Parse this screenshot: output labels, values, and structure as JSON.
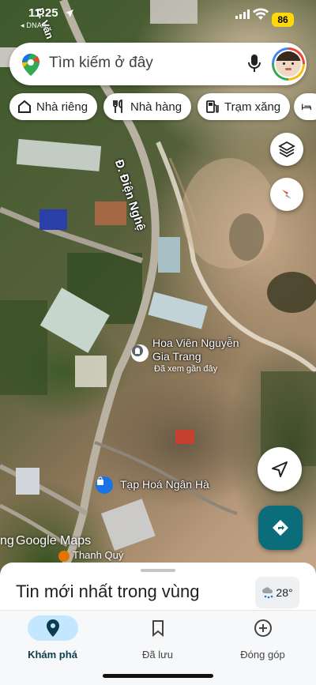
{
  "status_bar": {
    "time": "11:25",
    "carrier": "DNAIL",
    "battery": "86"
  },
  "search": {
    "placeholder": "Tìm kiếm ở đây"
  },
  "chips": [
    {
      "label": "Nhà riêng",
      "icon": "home-icon"
    },
    {
      "label": "Nhà hàng",
      "icon": "restaurant-icon"
    },
    {
      "label": "Trạm xăng",
      "icon": "gas-station-icon"
    },
    {
      "label": "",
      "icon": "hotel-icon"
    }
  ],
  "map": {
    "road_main": "Đ. Điện Nghệ",
    "road_top": "Đ. Văn",
    "poi_garden": {
      "name": "Hoa Viên Nguyễn Gia Trang",
      "line1": "Hoa Viên Nguyễn",
      "line2": "Gia Trang",
      "sub": "Đã xem gần đây",
      "icon": "cemetery-icon"
    },
    "poi_store": {
      "name": "Tạp Hoá Ngân Hà",
      "icon": "shopping-bag-icon"
    },
    "google_logo": "Google Maps",
    "google_prefix": "ng",
    "bottom_place": "Thanh Quý"
  },
  "bottom_sheet": {
    "title": "Tin mới nhất trong vùng",
    "weather": "28°"
  },
  "nav": [
    {
      "label": "Khám phá",
      "icon": "explore-pin-icon",
      "active": true
    },
    {
      "label": "Đã lưu",
      "icon": "bookmark-icon",
      "active": false
    },
    {
      "label": "Đóng góp",
      "icon": "add-circle-icon",
      "active": false
    }
  ]
}
